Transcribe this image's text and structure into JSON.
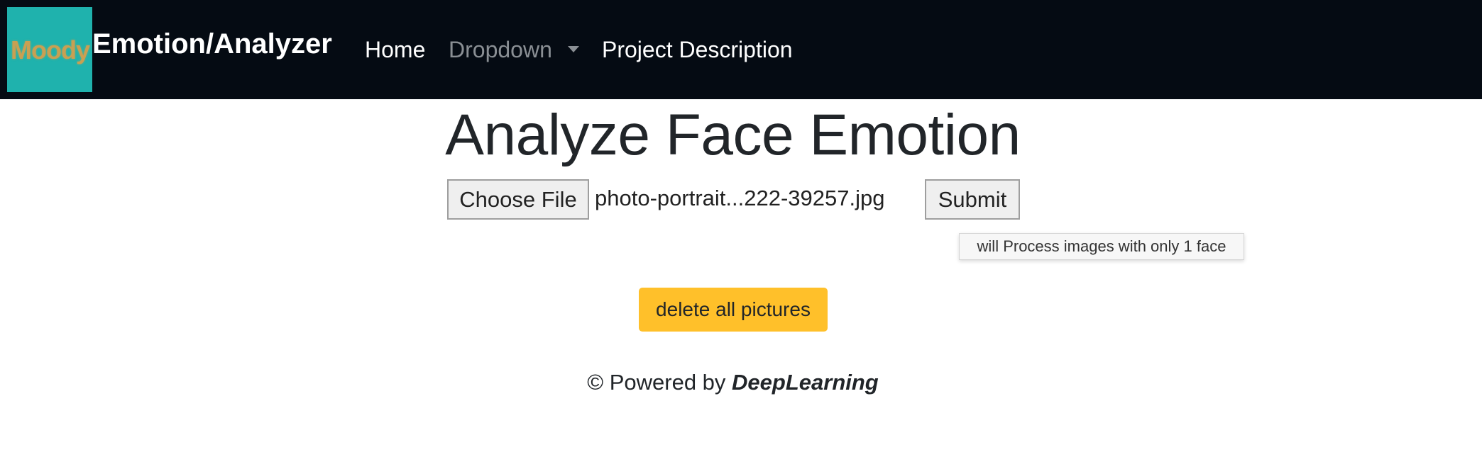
{
  "navbar": {
    "logo_text": "Moody",
    "brand": "Emotion/Analyzer",
    "links": [
      {
        "label": "Home"
      },
      {
        "label": "Dropdown"
      },
      {
        "label": "Project Description"
      }
    ]
  },
  "main": {
    "title": "Analyze Face Emotion",
    "file_button_label": "Choose File",
    "file_name": "photo-portrait...222-39257.jpg",
    "submit_label": "Submit",
    "tooltip": "will Process images with only 1 face",
    "delete_label": "delete all pictures"
  },
  "footer": {
    "prefix": "© Powered by ",
    "emphasis": "DeepLearning"
  },
  "colors": {
    "navbar_bg": "#050b13",
    "logo_bg": "#1fb2ad",
    "logo_text": "#c9a052",
    "delete_button": "#ffc02a",
    "dropdown_link": "#8a8f94"
  }
}
